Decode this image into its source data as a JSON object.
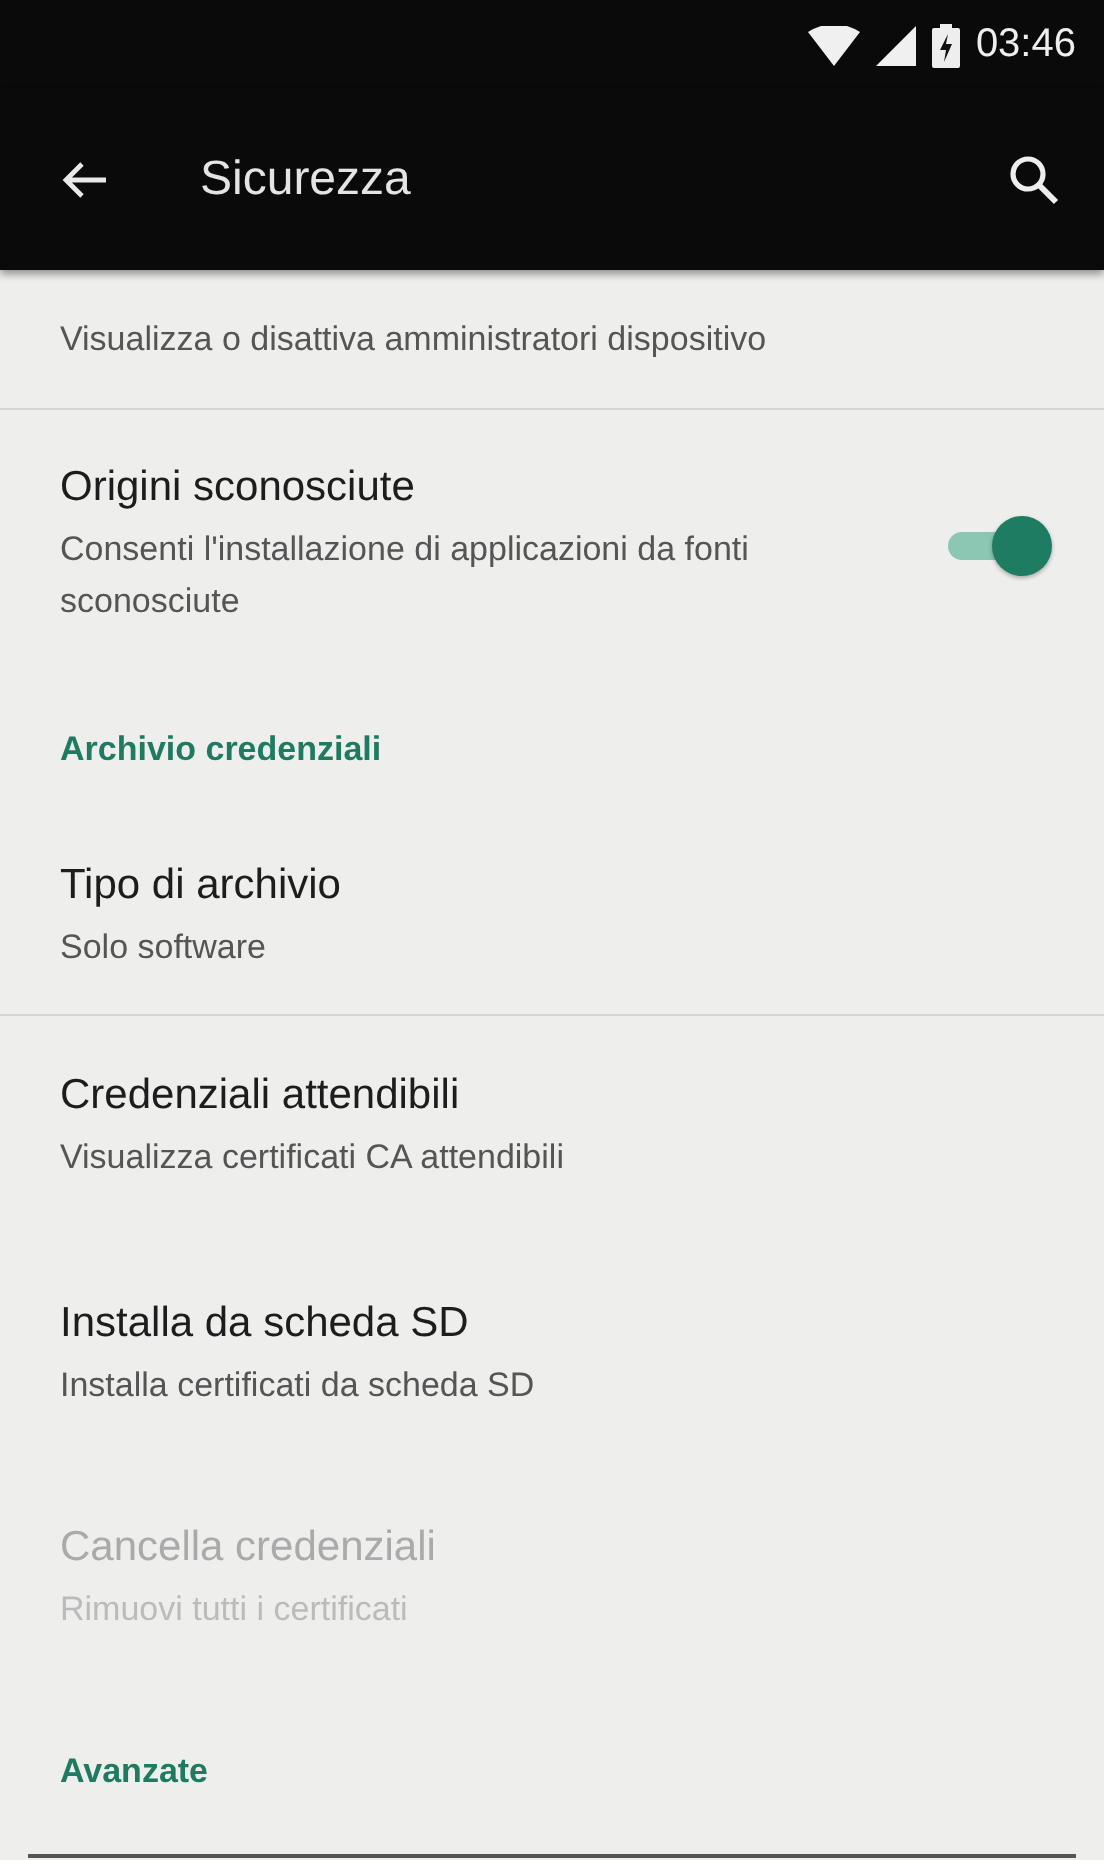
{
  "status_bar": {
    "time": "03:46"
  },
  "app_bar": {
    "title": "Sicurezza"
  },
  "list": [
    {
      "kind": "item",
      "summary": "Visualizza o disattiva amministratori dispositivo",
      "disabled": false,
      "divider": true
    },
    {
      "kind": "item",
      "title": "Origini sconosciute",
      "summary": "Consenti l'installazione di applicazioni da fonti sconosciute",
      "disabled": false,
      "divider": false,
      "switch": {
        "on": true
      }
    },
    {
      "kind": "header",
      "title": "Archivio credenziali"
    },
    {
      "kind": "item",
      "title": "Tipo di archivio",
      "summary": "Solo software",
      "disabled": false,
      "divider": true
    },
    {
      "kind": "item",
      "title": "Credenziali attendibili",
      "summary": "Visualizza certificati CA attendibili",
      "disabled": false,
      "divider": false
    },
    {
      "kind": "item",
      "title": "Installa da scheda SD",
      "summary": "Installa certificati da scheda SD",
      "disabled": false,
      "divider": false
    },
    {
      "kind": "item",
      "title": "Cancella credenziali",
      "summary": "Rimuovi tutti i certificati",
      "disabled": true,
      "divider": false
    },
    {
      "kind": "header",
      "title": "Avanzate"
    }
  ]
}
